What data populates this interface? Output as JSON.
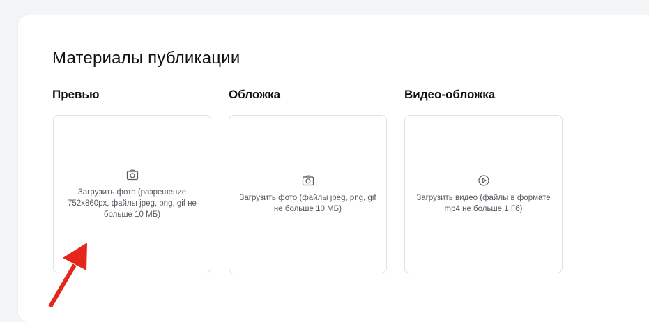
{
  "section": {
    "title": "Материалы публикации"
  },
  "columns": [
    {
      "title": "Превью",
      "icon": "camera-icon",
      "hint": "Загрузить фото (разрешение 752x860px, файлы jpeg, png, gif не больше 10 МБ)"
    },
    {
      "title": "Обложка",
      "icon": "camera-icon",
      "hint": "Загрузить фото (файлы jpeg, png, gif не больше 10 МБ)"
    },
    {
      "title": "Видео-обложка",
      "icon": "play-circle-icon",
      "hint": "Загрузить видео (файлы в формате mp4 не больше 1 Гб)"
    }
  ],
  "colors": {
    "card_bg": "#ffffff",
    "page_bg": "#f4f5f7",
    "border": "#dfe1e5",
    "hint_text": "#555a61",
    "annotation_arrow": "#e5261a"
  }
}
